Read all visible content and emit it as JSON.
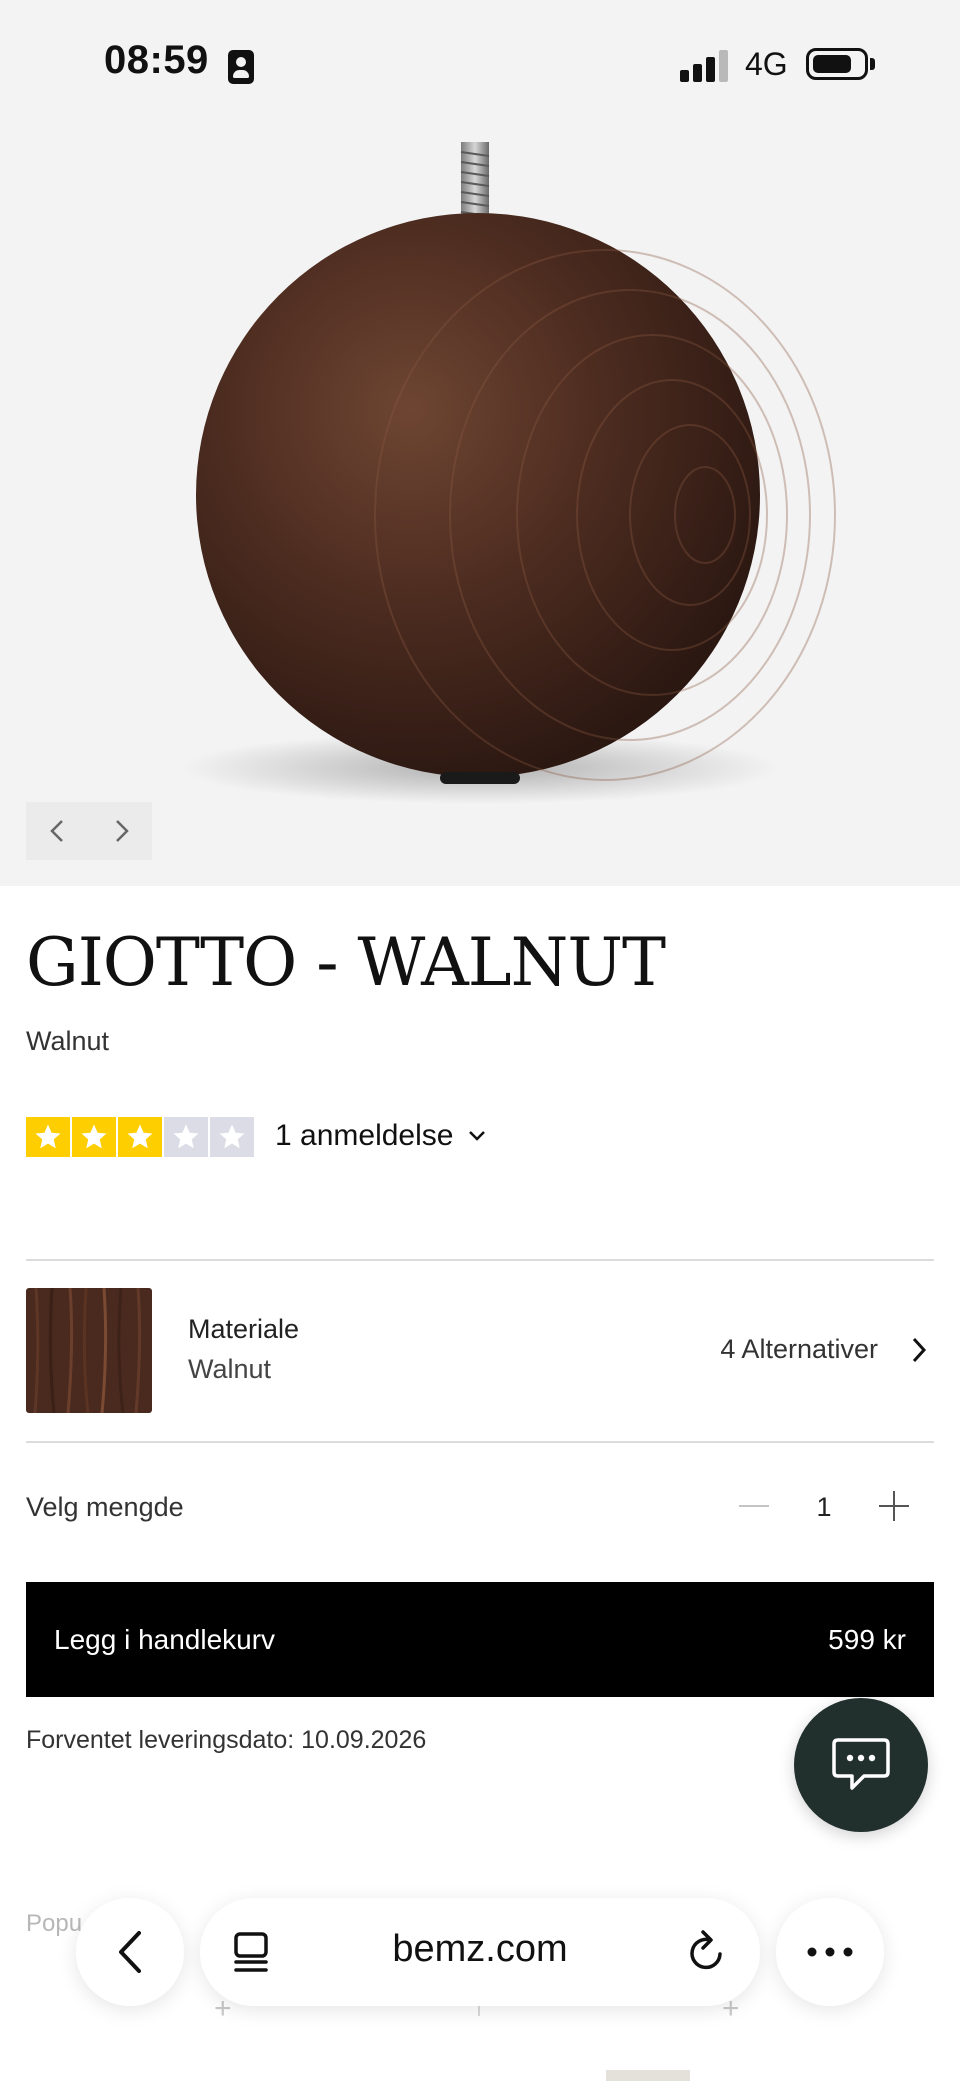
{
  "status_bar": {
    "time": "08:59",
    "network": "4G",
    "icons": [
      "id-card-icon",
      "signal-bars-icon",
      "battery-icon"
    ]
  },
  "product": {
    "title": "GIOTTO - WALNUT",
    "subtitle": "Walnut",
    "image_icon": "wooden-ball-leg-icon",
    "colors": {
      "wood": "#4a2a1f",
      "star_on": "#ffce00",
      "star_off": "#dcdce6",
      "fab": "#22302d"
    }
  },
  "carousel": {
    "prev_icon": "chevron-left-icon",
    "next_icon": "chevron-right-icon"
  },
  "rating": {
    "value": 3,
    "max": 5,
    "review_count_text": "1 anmeldelse"
  },
  "material": {
    "label": "Materiale",
    "value": "Walnut",
    "alternatives_text": "4 Alternativer"
  },
  "quantity": {
    "label": "Velg mengde",
    "value": "1"
  },
  "cart": {
    "button_label": "Legg i handlekurv",
    "price": "599 kr"
  },
  "delivery": {
    "text": "Forventet leveringsdato: 10.09.2026"
  },
  "below_fold": {
    "partial_heading": "Popu"
  },
  "browser": {
    "url": "bemz.com",
    "back_icon": "chevron-left-icon",
    "tabs_icon": "tabs-icon",
    "reload_icon": "reload-icon",
    "more_icon": "more-dots-icon"
  }
}
